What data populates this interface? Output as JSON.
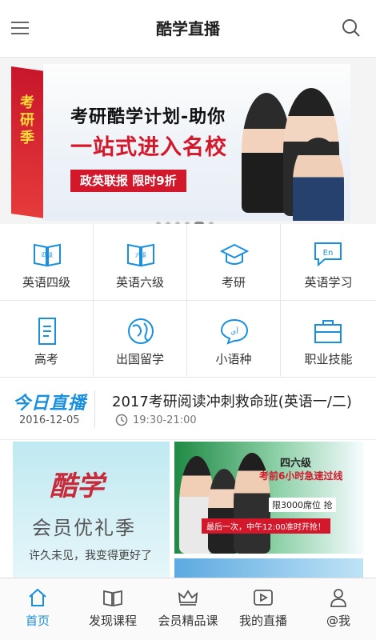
{
  "header": {
    "title": "酷学直播"
  },
  "banner": {
    "side_text": "考研季",
    "line1": "考研酷学计划-助你",
    "line2": "一站式进入名校",
    "tag": "政英联报  限时9折"
  },
  "categories": [
    {
      "label": "英语四级",
      "icon_text": "四级"
    },
    {
      "label": "英语六级",
      "icon_text": "六级"
    },
    {
      "label": "考研",
      "icon_text": ""
    },
    {
      "label": "英语学习",
      "icon_text": "En"
    },
    {
      "label": "高考",
      "icon_text": ""
    },
    {
      "label": "出国留学",
      "icon_text": ""
    },
    {
      "label": "小语种",
      "icon_text": "أي"
    },
    {
      "label": "职业技能",
      "icon_text": ""
    }
  ],
  "live": {
    "logo": "今日直播",
    "date": "2016-12-05",
    "title": "2017考研阅读冲刺救命班(英语一/二)",
    "time": "19:30-21:00"
  },
  "promo_left": {
    "brand": "酷学",
    "title": "会员优礼季",
    "subtitle": "许久未见，我变得更好了"
  },
  "promo_right": {
    "level": "四六级",
    "headline": "考前6小时急速过线",
    "seats": "限3000席位 抢",
    "note": "最后一次，中午12:00准时开抢！"
  },
  "tabs": [
    {
      "label": "首页",
      "active": true
    },
    {
      "label": "发现课程",
      "active": false
    },
    {
      "label": "会员精品课",
      "active": false
    },
    {
      "label": "我的直播",
      "active": false
    },
    {
      "label": "@我",
      "active": false
    }
  ],
  "colors": {
    "accent": "#1a8fde",
    "brand_red": "#d3182b"
  }
}
